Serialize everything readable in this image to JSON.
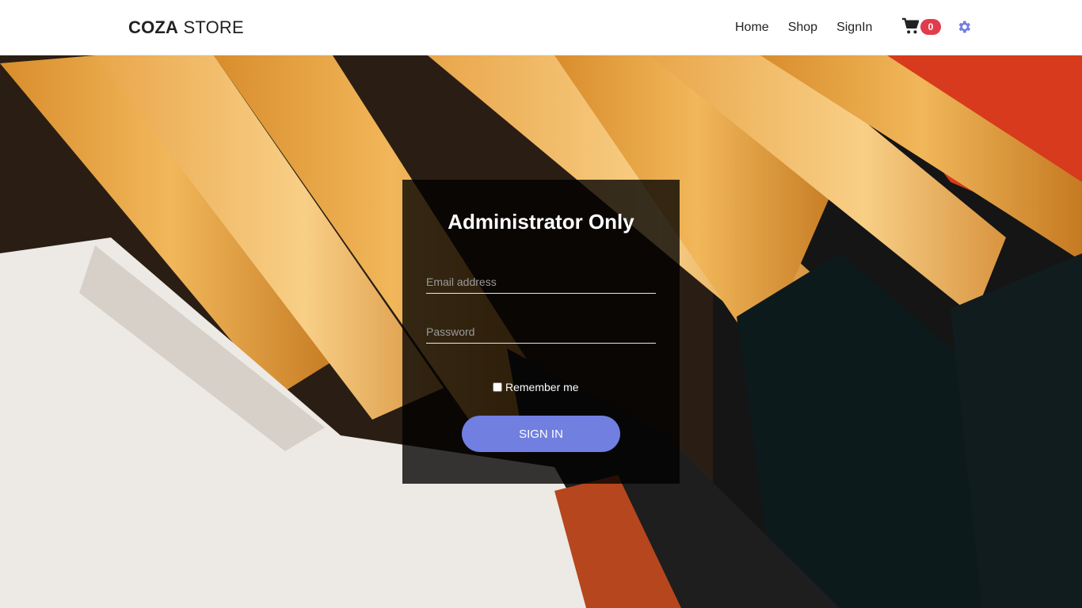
{
  "header": {
    "brand_bold": "COZA",
    "brand_light": "STORE",
    "nav": [
      {
        "label": "Home"
      },
      {
        "label": "Shop"
      },
      {
        "label": "SignIn"
      }
    ],
    "cart_count": "0",
    "cart_icon": "shopping-cart-icon",
    "settings_icon": "gear-icon"
  },
  "login": {
    "title": "Administrator Only",
    "email_placeholder": "Email address",
    "password_placeholder": "Password",
    "remember_label": "Remember me",
    "submit_label": "SIGN IN"
  },
  "colors": {
    "accent": "#717fe0",
    "badge": "#e03c4d"
  }
}
